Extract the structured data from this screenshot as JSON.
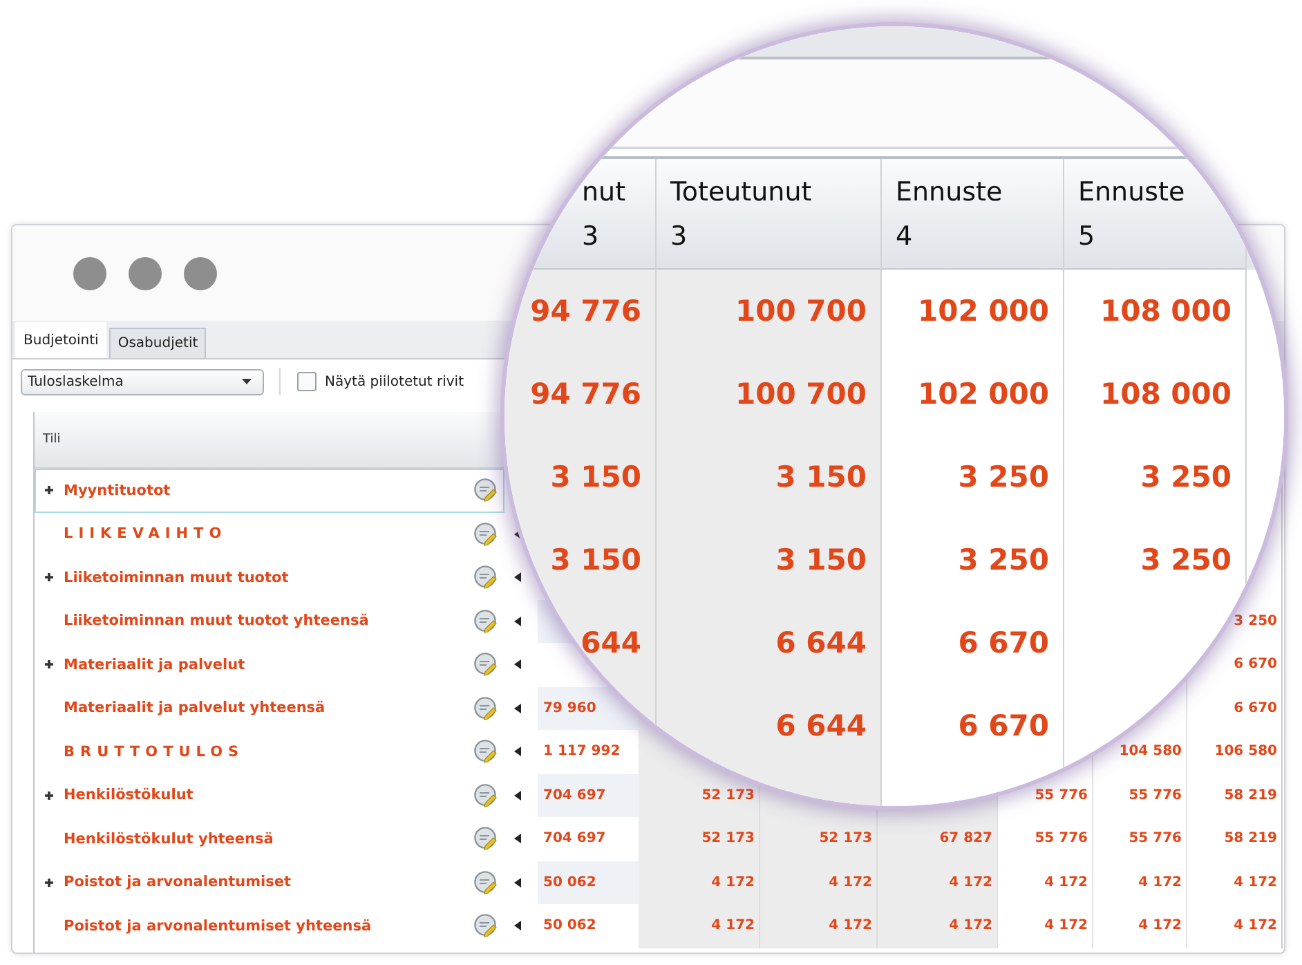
{
  "tabs": [
    {
      "label": "Budjetointi",
      "selected": true
    },
    {
      "label": "Osabudjetit",
      "selected": false
    }
  ],
  "toolbar": {
    "dropdown": {
      "value": "Tuloslaskelma"
    },
    "checkbox": {
      "label": "Näytä piilotetut rivit",
      "checked": false
    }
  },
  "grid": {
    "header": "Tili",
    "rows": [
      {
        "label": "Myyntituotot",
        "kind": "account",
        "expandable": true,
        "selected": true
      },
      {
        "label": "LIIKEVAIHTO",
        "kind": "heading",
        "expandable": false,
        "selected": false
      },
      {
        "label": "Liiketoiminnan muut tuotot",
        "kind": "account",
        "expandable": true,
        "selected": false
      },
      {
        "label": "Liiketoiminnan muut tuotot yhteensä",
        "kind": "account",
        "expandable": false,
        "selected": false,
        "right_values": [
          "3 250"
        ]
      },
      {
        "label": "Materiaalit ja palvelut",
        "kind": "account",
        "expandable": true,
        "selected": false,
        "right_values": [
          "6 670"
        ]
      },
      {
        "label": "Materiaalit ja palvelut yhteensä",
        "kind": "account",
        "expandable": false,
        "selected": false,
        "left_values": [
          "79 960"
        ],
        "right_values": [
          "6 670"
        ]
      },
      {
        "label": "BRUTTOTULOS",
        "kind": "heading",
        "expandable": false,
        "selected": false,
        "left_values": [
          "1 117 992"
        ],
        "right_values": [
          "104 580",
          "106 580"
        ]
      },
      {
        "label": "Henkilöstökulut",
        "kind": "account",
        "expandable": true,
        "selected": false,
        "left_values": [
          "704 697",
          "52 173"
        ],
        "right_values": [
          "55 776",
          "55 776",
          "58 219"
        ]
      },
      {
        "label": "Henkilöstökulut yhteensä",
        "kind": "account",
        "expandable": false,
        "selected": false,
        "left_values": [
          "704 697",
          "52 173",
          "52 173",
          "67 827",
          "55 776",
          "55 776",
          "58 219"
        ]
      },
      {
        "label": "Poistot ja arvonalentumiset",
        "kind": "account",
        "expandable": true,
        "selected": false,
        "left_values": [
          "50 062",
          "4 172",
          "4 172",
          "4 172",
          "4 172",
          "4 172",
          "4 172"
        ]
      },
      {
        "label": "Poistot ja arvonalentumiset yhteensä",
        "kind": "account",
        "expandable": false,
        "selected": false,
        "left_values": [
          "50 062",
          "4 172",
          "4 172",
          "4 172",
          "4 172",
          "4 172",
          "4 172"
        ]
      }
    ]
  },
  "magnifier": {
    "columns": [
      {
        "line_1": "nut",
        "line_2": "3",
        "values": [
          "94 776",
          "94 776",
          "3 150",
          "3 150",
          "644"
        ]
      },
      {
        "line_1": "Toteutunut",
        "line_2": "3",
        "values": [
          "100 700",
          "100 700",
          "3 150",
          "3 150",
          "6 644",
          "6 644"
        ]
      },
      {
        "line_1": "Ennuste",
        "line_2": "4",
        "values": [
          "102 000",
          "102 000",
          "3 250",
          "3 250",
          "6 670",
          "6 670"
        ]
      },
      {
        "line_1": "Ennuste",
        "line_2": "5",
        "values": [
          "108 000",
          "108 000",
          "3 250",
          "3 250"
        ]
      }
    ]
  }
}
